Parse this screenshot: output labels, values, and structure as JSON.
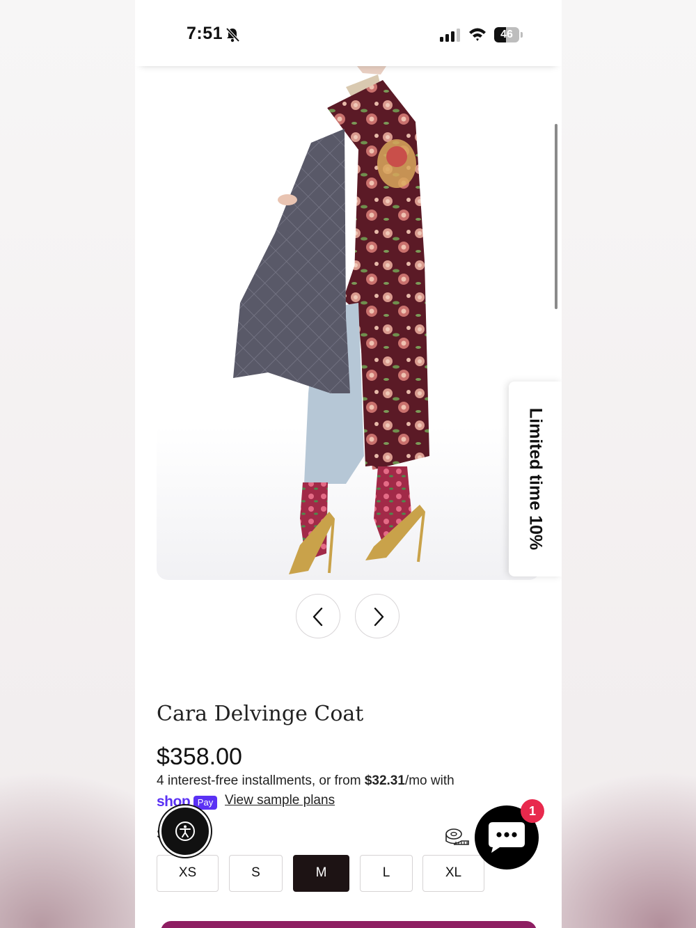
{
  "status_bar": {
    "time": "7:51",
    "battery": "46",
    "battery_level": 0.46
  },
  "promo_tab": {
    "label": "Limited time 10%"
  },
  "product": {
    "title": "Cara Delvinge Coat",
    "price": "$358.00",
    "installments_prefix": "4 interest-free installments, or from ",
    "installments_amount": "$32.31",
    "installments_suffix": "/mo with",
    "shop_word": "shop",
    "pay_badge": "Pay",
    "sample_plans_link": "View sample plans",
    "size_label_stub": "S"
  },
  "sizes": {
    "options": [
      "XS",
      "S",
      "M",
      "L",
      "XL"
    ],
    "selected": "M"
  },
  "chat": {
    "unread_count": "1"
  },
  "colors": {
    "shop_pay_purple": "#5a31f4",
    "selected_size_bg": "#1d1314",
    "chat_badge_red": "#e8294d",
    "cart_button": "#8e1e62",
    "coat_burgundy": "#5b1a26",
    "quilt_lining": "#5a5a6a"
  },
  "icons": {
    "bell": "bell-slash-icon",
    "signal": "cellular-signal-icon",
    "wifi": "wifi-icon",
    "battery": "battery-icon",
    "prev": "chevron-left-icon",
    "next": "chevron-right-icon",
    "accessibility": "accessibility-icon",
    "size_guide": "measuring-tape-icon",
    "chat": "chat-bubble-icon"
  }
}
